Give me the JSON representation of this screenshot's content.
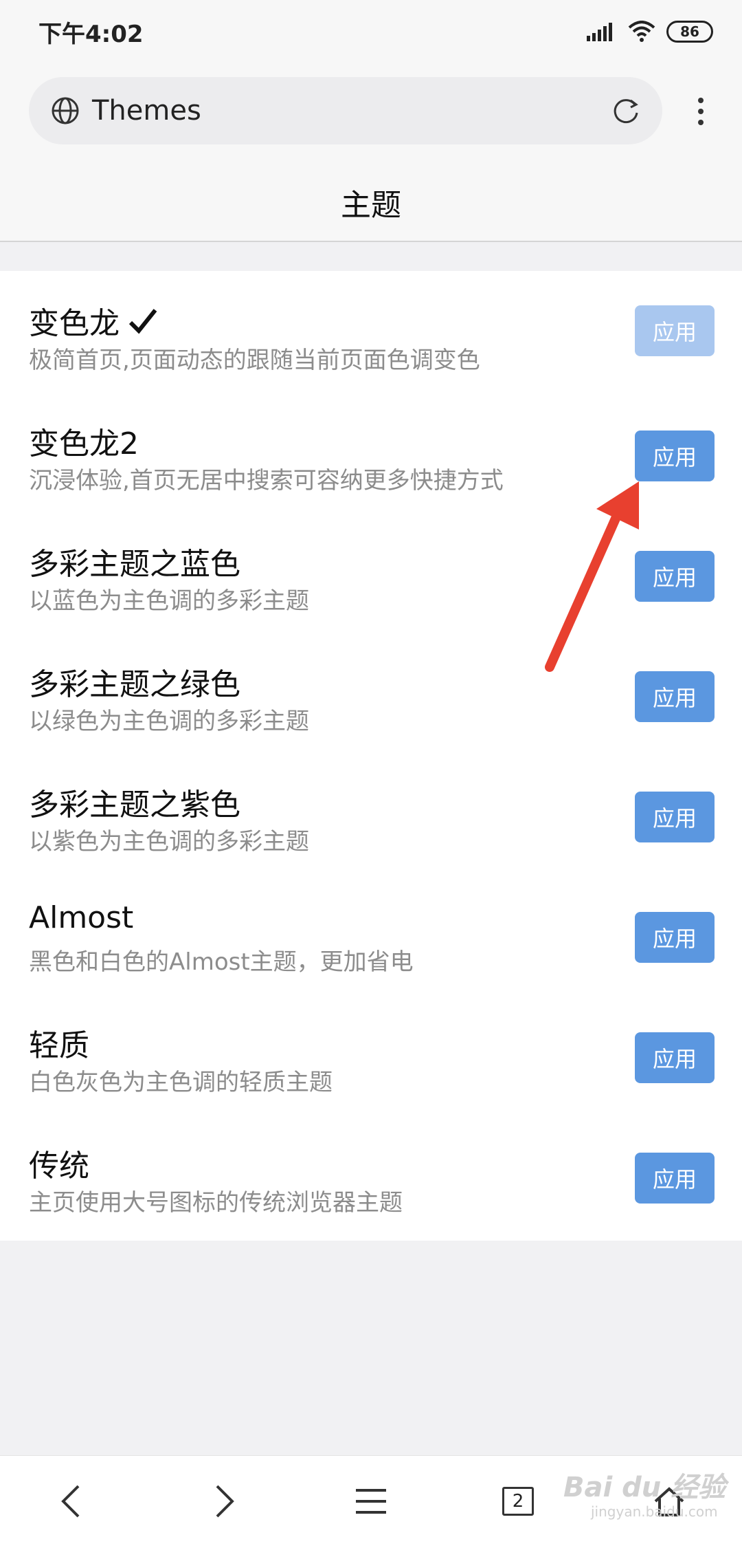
{
  "status_bar": {
    "time": "下午4:02",
    "battery": "86",
    "icons": [
      "signal-icon",
      "wifi-icon",
      "battery-icon"
    ]
  },
  "address_bar": {
    "url_text": "Themes",
    "left_icon": "globe-icon",
    "right_icon": "reload-icon",
    "menu_icon": "more-vertical-icon"
  },
  "page": {
    "title": "主题"
  },
  "themes": [
    {
      "name": "变色龙",
      "description": "极简首页,页面动态的跟随当前页面色调变色",
      "apply_label": "应用",
      "selected": true
    },
    {
      "name": "变色龙2",
      "description": "沉浸体验,首页无居中搜索可容纳更多快捷方式",
      "apply_label": "应用",
      "selected": false
    },
    {
      "name": "多彩主题之蓝色",
      "description": "以蓝色为主色调的多彩主题",
      "apply_label": "应用",
      "selected": false
    },
    {
      "name": "多彩主题之绿色",
      "description": "以绿色为主色调的多彩主题",
      "apply_label": "应用",
      "selected": false
    },
    {
      "name": "多彩主题之紫色",
      "description": "以紫色为主色调的多彩主题",
      "apply_label": "应用",
      "selected": false
    },
    {
      "name": "Almost",
      "description": "黑色和白色的Almost主题，更加省电",
      "apply_label": "应用",
      "selected": false
    },
    {
      "name": "轻质",
      "description": "白色灰色为主色调的轻质主题",
      "apply_label": "应用",
      "selected": false
    },
    {
      "name": "传统",
      "description": "主页使用大号图标的传统浏览器主题",
      "apply_label": "应用",
      "selected": false
    }
  ],
  "bottom_nav": {
    "tab_count": "2",
    "icons": [
      "back-icon",
      "forward-icon",
      "menu-icon",
      "tabs-icon",
      "home-icon"
    ]
  },
  "watermark": {
    "text": "Bai du 经验",
    "sub": "jingyan.baidu.com"
  },
  "colors": {
    "apply_button": "#5b97e0",
    "apply_button_disabled": "#a9c7ef",
    "annotation_arrow": "#e8402f"
  }
}
